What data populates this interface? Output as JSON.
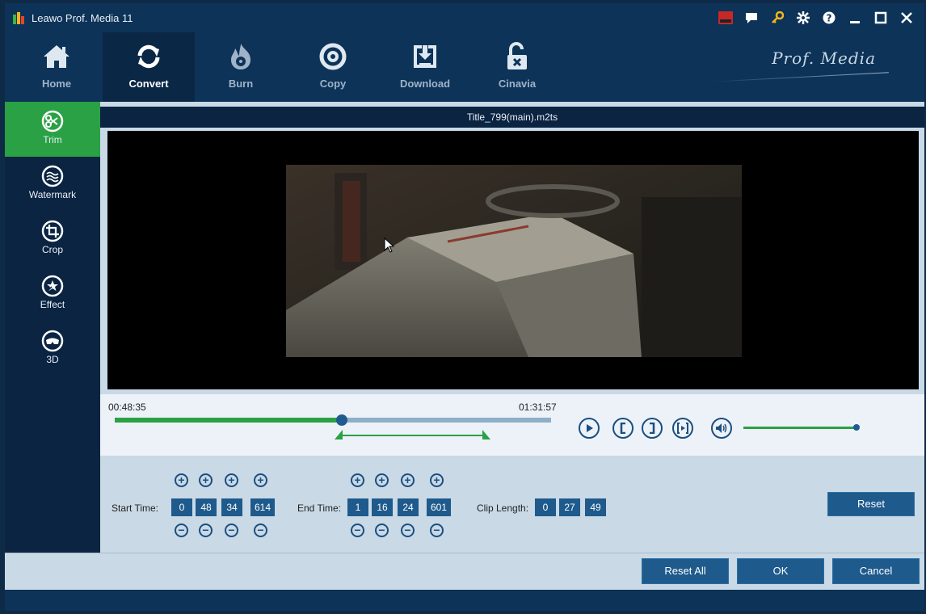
{
  "app": {
    "title": "Leawo Prof. Media 11",
    "brand": "Prof. Media"
  },
  "titlebar_icons": [
    "amd-icon",
    "chat-icon",
    "key-icon",
    "gear-icon",
    "help-icon",
    "minimize-icon",
    "maximize-icon",
    "close-icon"
  ],
  "toolbar": {
    "items": [
      {
        "label": "Home",
        "icon": "home-icon"
      },
      {
        "label": "Convert",
        "icon": "convert-icon",
        "active": true
      },
      {
        "label": "Burn",
        "icon": "burn-icon"
      },
      {
        "label": "Copy",
        "icon": "copy-icon"
      },
      {
        "label": "Download",
        "icon": "download-icon"
      },
      {
        "label": "Cinavia",
        "icon": "cinavia-icon"
      }
    ]
  },
  "sidebar": {
    "items": [
      {
        "label": "Trim",
        "icon": "scissors-icon",
        "active": true
      },
      {
        "label": "Watermark",
        "icon": "watermark-icon"
      },
      {
        "label": "Crop",
        "icon": "crop-icon"
      },
      {
        "label": "Effect",
        "icon": "effect-icon"
      },
      {
        "label": "3D",
        "icon": "3d-glasses-icon"
      }
    ]
  },
  "file": {
    "name": "Title_799(main).m2ts"
  },
  "timeline": {
    "start_label": "00:48:35",
    "end_label": "01:31:57",
    "played_fraction": 0.52,
    "range_start_fraction": 0.515,
    "range_end_fraction": 0.85,
    "volume_fraction": 1.0
  },
  "trim": {
    "start_label": "Start Time:",
    "start_values": [
      "0",
      "48",
      "34",
      "614"
    ],
    "end_label": "End Time:",
    "end_values": [
      "1",
      "16",
      "24",
      "601"
    ],
    "clip_label": "Clip Length:",
    "clip_values": [
      "0",
      "27",
      "49"
    ],
    "reset_label": "Reset"
  },
  "footer": {
    "reset_all_label": "Reset All",
    "ok_label": "OK",
    "cancel_label": "Cancel"
  },
  "colors": {
    "accent_green": "#2aa145",
    "dark_navy": "#0d3358",
    "button_blue": "#1e5a8c"
  }
}
